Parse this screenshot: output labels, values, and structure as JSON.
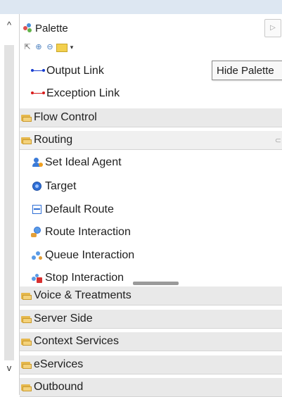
{
  "palette": {
    "title": "Palette",
    "hide_button_glyph": "▷",
    "tooltip": "Hide Palette",
    "tools": [
      "select-tool",
      "zoom-in-tool",
      "zoom-out-tool",
      "note-tool",
      "dropdown"
    ],
    "links": [
      {
        "label": "Output Link",
        "color": "#1a3fd1",
        "icon": "output-link-icon"
      },
      {
        "label": "Exception Link",
        "color": "#d81b1b",
        "icon": "exception-link-icon"
      }
    ],
    "drawers": {
      "flow_control": "Flow Control",
      "routing": "Routing",
      "voice_treatments": "Voice & Treatments",
      "server_side": "Server Side",
      "context_services": "Context Services",
      "eservices": "eServices",
      "outbound": "Outbound"
    },
    "routing_items": [
      {
        "label": "Set Ideal Agent",
        "icon": "set-ideal-agent-icon"
      },
      {
        "label": "Target",
        "icon": "target-icon"
      },
      {
        "label": "Default Route",
        "icon": "default-route-icon"
      },
      {
        "label": "Route Interaction",
        "icon": "route-interaction-icon"
      },
      {
        "label": "Queue Interaction",
        "icon": "queue-interaction-icon"
      },
      {
        "label": "Stop Interaction",
        "icon": "stop-interaction-icon"
      }
    ],
    "colors": {
      "accent": "#3b7bd8",
      "drawer_bg": "#e9e9e9",
      "folder": "#f4d27b"
    }
  }
}
